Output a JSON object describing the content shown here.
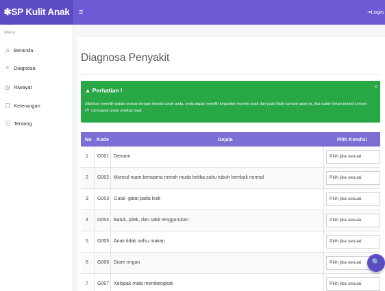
{
  "header": {
    "brand": "✱SP Kulit Anak",
    "menu_toggle": "≡",
    "logout": "⇥Login"
  },
  "sidebar": {
    "menu_label": "Menu",
    "items": [
      {
        "icon": "⌂",
        "label": "Beranda"
      },
      {
        "icon": "⌕",
        "label": "Diagnosa"
      },
      {
        "icon": "◷",
        "label": "Riwayat"
      },
      {
        "icon": "☐",
        "label": "Keterangan"
      },
      {
        "icon": "ⓘ",
        "label": "Tentang"
      }
    ]
  },
  "main": {
    "title": "Diagnosa Penyakit",
    "alert": {
      "title": "Perhatian !",
      "text": "Silahkan memilih gejala sesuai dengan kondisi anak anda, anda dapat memilih kepastian kondisi anak dari pasti tidak sampai pasti ya, jika sudah tekan tombol proses (🔍) di bawah untuk melihat hasil.",
      "close": "×"
    },
    "table": {
      "headers": {
        "no": "No",
        "kode": "Kode",
        "gejala": "Gejala",
        "kondisi": "Pilih Kondisi"
      },
      "rows": [
        {
          "no": "1",
          "kode": "G001",
          "gejala": "Demam",
          "kondisi": "Pilih jika sesuai"
        },
        {
          "no": "2",
          "kode": "G002",
          "gejala": "Muncul ruam berwarna merah muda ketika suhu tubuh kembali normal",
          "kondisi": "Pilih jika sesuai"
        },
        {
          "no": "3",
          "kode": "G003",
          "gejala": "Gatal -gatal pada kulit",
          "kondisi": "Pilih jika sesuai"
        },
        {
          "no": "4",
          "kode": "G004",
          "gejala": "Batuk, pilek, dan sakit tenggorokan",
          "kondisi": "Pilih jika sesuai"
        },
        {
          "no": "5",
          "kode": "G005",
          "gejala": "Anak tidak nafsu makan",
          "kondisi": "Pilih jika sesuai"
        },
        {
          "no": "6",
          "kode": "G006",
          "gejala": "Diare ringan",
          "kondisi": "Pilih jika sesuai"
        },
        {
          "no": "7",
          "kode": "G007",
          "gejala": "Kelopak mata membengkak",
          "kondisi": "Pilih jika sesuai"
        }
      ]
    }
  },
  "fab": {
    "icon": "🔍"
  }
}
